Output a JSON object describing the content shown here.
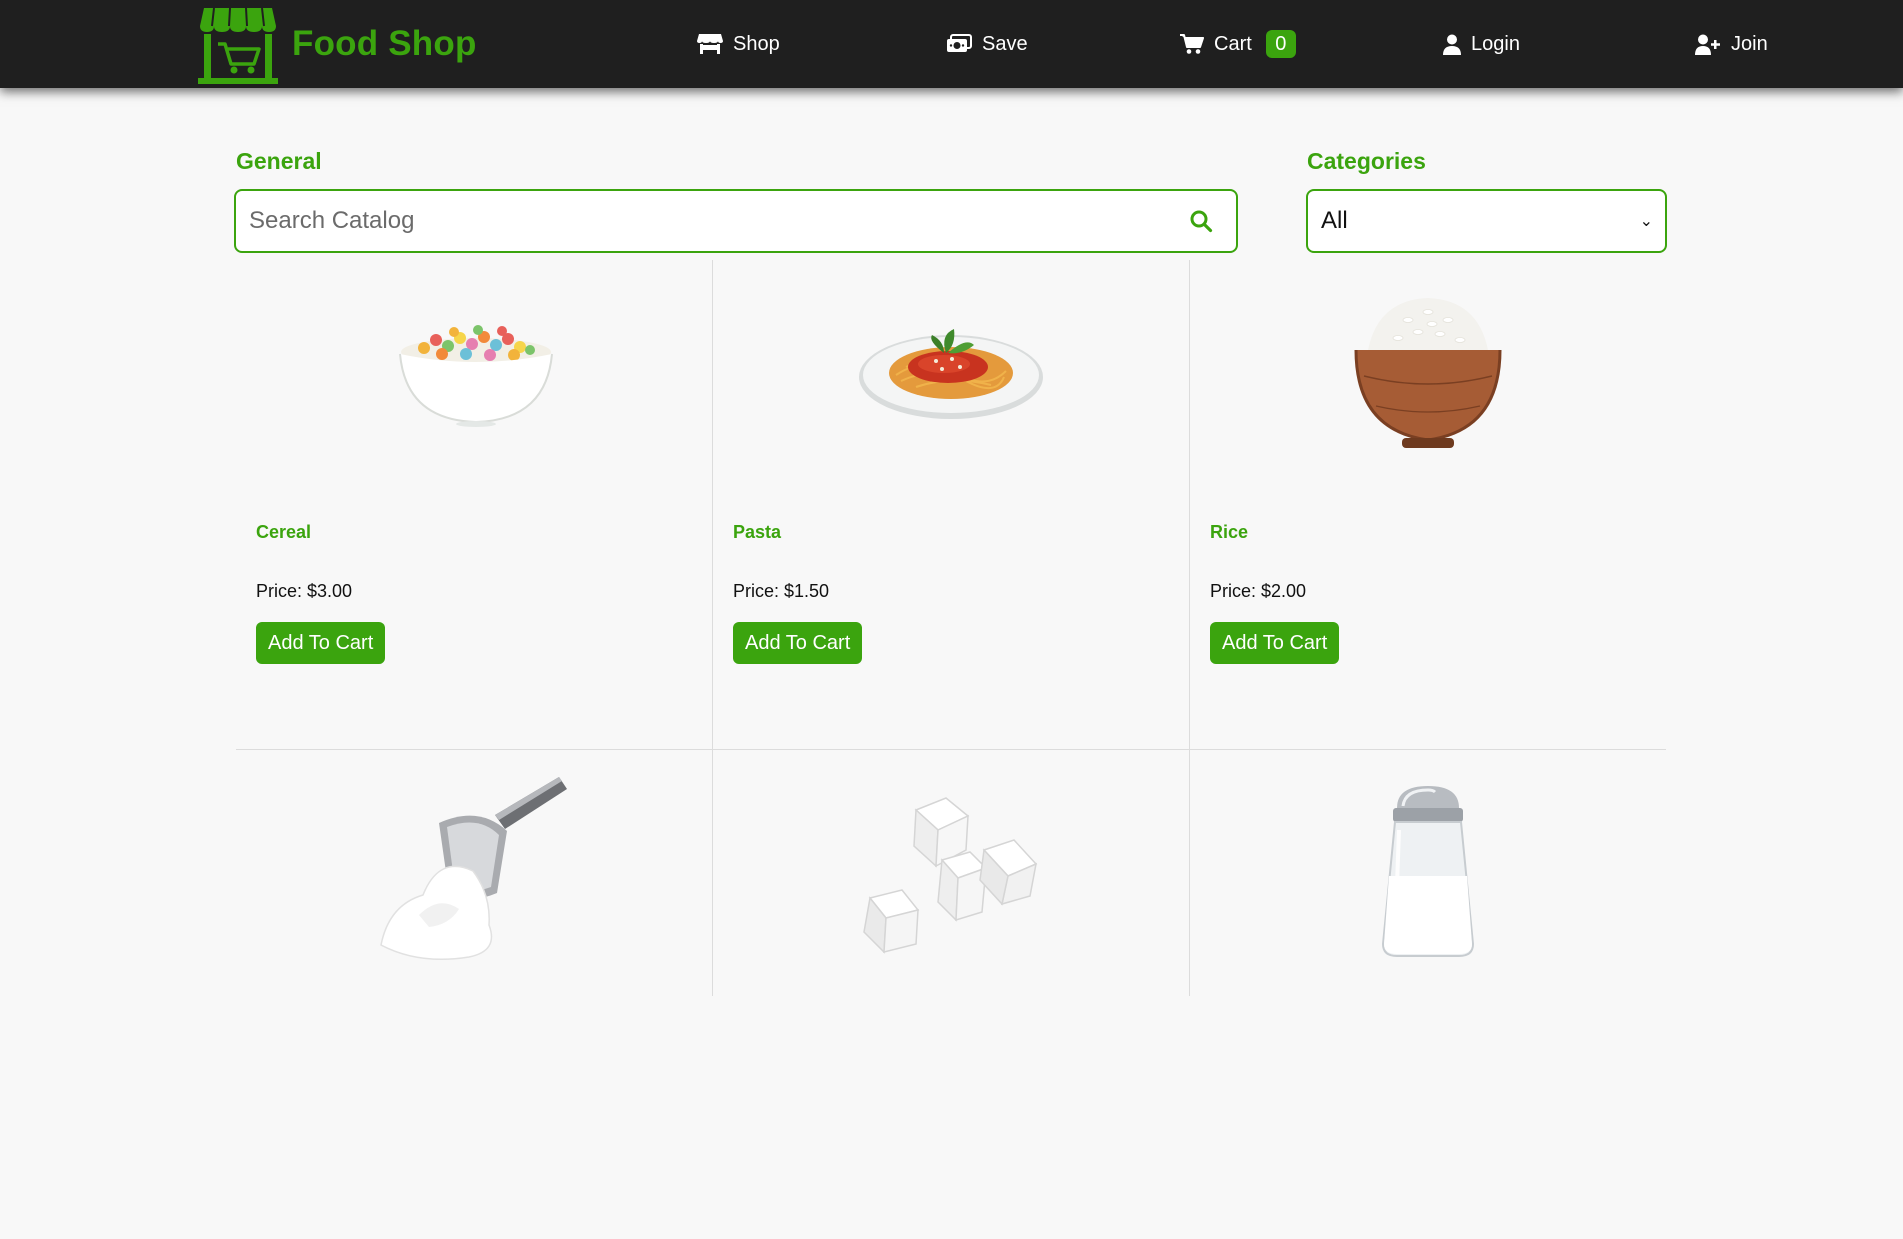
{
  "brand": {
    "name": "Food Shop",
    "logo_icon": "store-cart-icon",
    "color": "#3ba40e"
  },
  "nav": {
    "shop": {
      "label": "Shop",
      "icon": "store-icon"
    },
    "save": {
      "label": "Save",
      "icon": "money-icon"
    },
    "cart": {
      "label": "Cart",
      "icon": "cart-icon",
      "count": "0"
    },
    "login": {
      "label": "Login",
      "icon": "user-icon"
    },
    "join": {
      "label": "Join",
      "icon": "user-plus-icon"
    }
  },
  "filters": {
    "general_label": "General",
    "search_placeholder": "Search Catalog",
    "search_value": "",
    "search_icon": "search-icon",
    "categories_label": "Categories",
    "category_selected": "All"
  },
  "products": [
    {
      "name": "Cereal",
      "price": "Price: $3.00",
      "button": "Add To Cart",
      "image": "cereal-bowl"
    },
    {
      "name": "Pasta",
      "price": "Price: $1.50",
      "button": "Add To Cart",
      "image": "spaghetti-plate"
    },
    {
      "name": "Rice",
      "price": "Price: $2.00",
      "button": "Add To Cart",
      "image": "rice-bowl"
    },
    {
      "image": "flour-scoop"
    },
    {
      "image": "sugar-cubes"
    },
    {
      "image": "salt-shaker"
    }
  ],
  "colors": {
    "accent": "#3ba40e",
    "navbar": "#1f1f1f",
    "background": "#f8f8f8"
  }
}
